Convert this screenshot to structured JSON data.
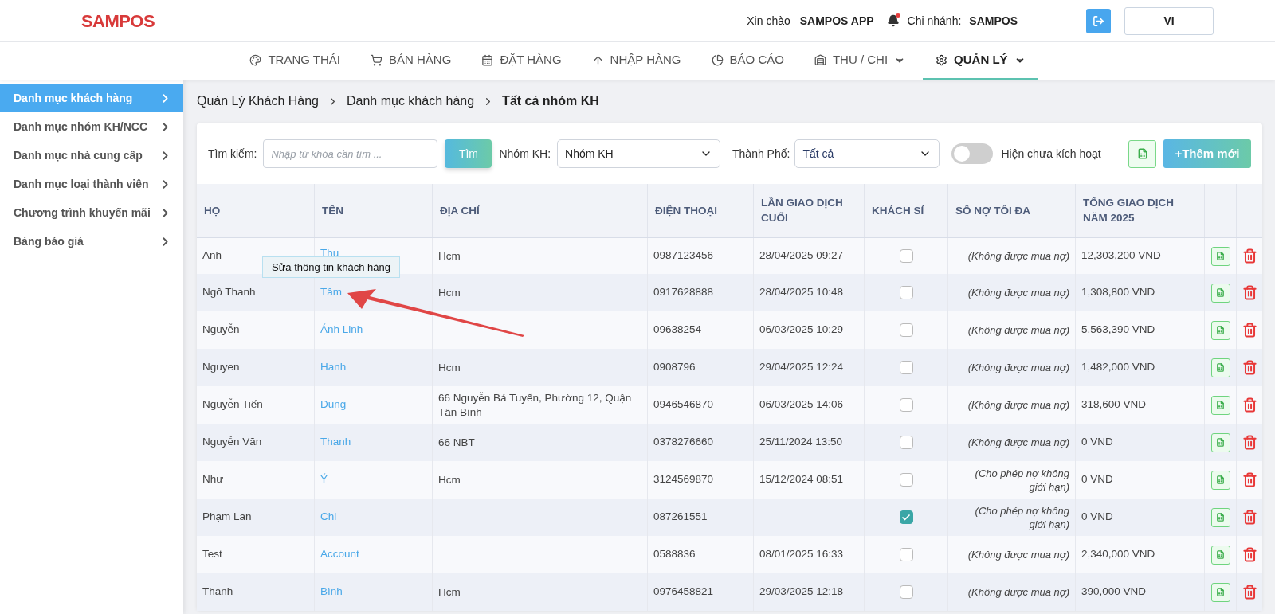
{
  "header": {
    "logo": "SAMPOS",
    "greeting": "Xin chào",
    "user": "SAMPOS APP",
    "branch_label": "Chi nhánh:",
    "branch": "SAMPOS",
    "language": "VI"
  },
  "nav": [
    {
      "label": "TRẠNG THÁI",
      "selected": false,
      "dropdown": false
    },
    {
      "label": "BÁN HÀNG",
      "selected": false,
      "dropdown": false
    },
    {
      "label": "ĐẶT HÀNG",
      "selected": false,
      "dropdown": false
    },
    {
      "label": "NHẬP HÀNG",
      "selected": false,
      "dropdown": false
    },
    {
      "label": "BÁO CÁO",
      "selected": false,
      "dropdown": false
    },
    {
      "label": "THU / CHI",
      "selected": false,
      "dropdown": true
    },
    {
      "label": "QUẢN LÝ",
      "selected": true,
      "dropdown": true
    }
  ],
  "sidebar": {
    "items": [
      {
        "label": "Danh mục khách hàng",
        "selected": true
      },
      {
        "label": "Danh mục nhóm KH/NCC",
        "selected": false
      },
      {
        "label": "Danh mục nhà cung cấp",
        "selected": false
      },
      {
        "label": "Danh mục loại thành viên",
        "selected": false
      },
      {
        "label": "Chương trình khuyến mãi",
        "selected": false
      },
      {
        "label": "Bảng báo giá",
        "selected": false
      }
    ]
  },
  "breadcrumb": [
    "Quản Lý Khách Hàng",
    "Danh mục khách hàng",
    "Tất cả nhóm KH"
  ],
  "filters": {
    "search_label": "Tìm kiếm:",
    "search_placeholder": "Nhập từ khóa cần tìm ...",
    "search_button": "Tìm",
    "group_label": "Nhóm KH:",
    "group_value": "Nhóm KH",
    "city_label": "Thành Phố:",
    "city_value": "Tất cả",
    "toggle": {
      "label": "Hiện chưa kích hoạt",
      "on": false
    },
    "add_button": "+Thêm mới"
  },
  "table": {
    "columns": [
      "HỌ",
      "TÊN",
      "ĐỊA CHỈ",
      "ĐIỆN THOẠI",
      "LẦN GIAO DỊCH CUỐI",
      "KHÁCH SỈ",
      "SỐ NỢ TỐI ĐA",
      "TỔNG GIAO DỊCH NĂM 2025"
    ],
    "rows": [
      {
        "last_name": "Anh",
        "first_name": "Thu",
        "address": "Hcm",
        "phone": "0987123456",
        "last_transaction": "28/04/2025 09:27",
        "wholesale": false,
        "debt_limit": "(Không được mua nợ)",
        "total": "12,303,200 VND"
      },
      {
        "last_name": "Ngô Thanh",
        "first_name": "Tâm",
        "address": "Hcm",
        "phone": "0917628888",
        "last_transaction": "28/04/2025 10:48",
        "wholesale": false,
        "debt_limit": "(Không được mua nợ)",
        "total": "1,308,800 VND"
      },
      {
        "last_name": "Nguyễn",
        "first_name": "Ánh Linh",
        "address": "",
        "phone": "09638254",
        "last_transaction": "06/03/2025 10:29",
        "wholesale": false,
        "debt_limit": "(Không được mua nợ)",
        "total": "5,563,390 VND"
      },
      {
        "last_name": "Nguyen",
        "first_name": "Hanh",
        "address": "Hcm",
        "phone": "0908796",
        "last_transaction": "29/04/2025 12:24",
        "wholesale": false,
        "debt_limit": "(Không được mua nợ)",
        "total": "1,482,000 VND"
      },
      {
        "last_name": "Nguyễn Tiến",
        "first_name": "Dũng",
        "address": "66 Nguyễn Bá Tuyển, Phường 12, Quận Tân Bình",
        "phone": "0946546870",
        "last_transaction": "06/03/2025 14:06",
        "wholesale": false,
        "debt_limit": "(Không được mua nợ)",
        "total": "318,600 VND"
      },
      {
        "last_name": "Nguyễn Văn",
        "first_name": "Thanh",
        "address": "66 NBT",
        "phone": "0378276660",
        "last_transaction": "25/11/2024 13:50",
        "wholesale": false,
        "debt_limit": "(Không được mua nợ)",
        "total": "0 VND"
      },
      {
        "last_name": "Như",
        "first_name": "Ý",
        "address": "Hcm",
        "phone": "3124569870",
        "last_transaction": "15/12/2024 08:51",
        "wholesale": false,
        "debt_limit": "(Cho phép nợ không giới hạn)",
        "total": "0 VND"
      },
      {
        "last_name": "Phạm Lan",
        "first_name": "Chi",
        "address": "",
        "phone": "087261551",
        "last_transaction": "",
        "wholesale": true,
        "debt_limit": "(Cho phép nợ không giới hạn)",
        "total": "0 VND"
      },
      {
        "last_name": "Test",
        "first_name": "Account",
        "address": "",
        "phone": "0588836",
        "last_transaction": "08/01/2025 16:33",
        "wholesale": false,
        "debt_limit": "(Không được mua nợ)",
        "total": "2,340,000 VND"
      },
      {
        "last_name": "Thanh",
        "first_name": "Bình",
        "address": "Hcm",
        "phone": "0976458821",
        "last_transaction": "29/03/2025 12:18",
        "wholesale": false,
        "debt_limit": "(Không được mua nợ)",
        "total": "390,000 VND"
      }
    ]
  },
  "tooltip": "Sửa thông tin khách hàng"
}
